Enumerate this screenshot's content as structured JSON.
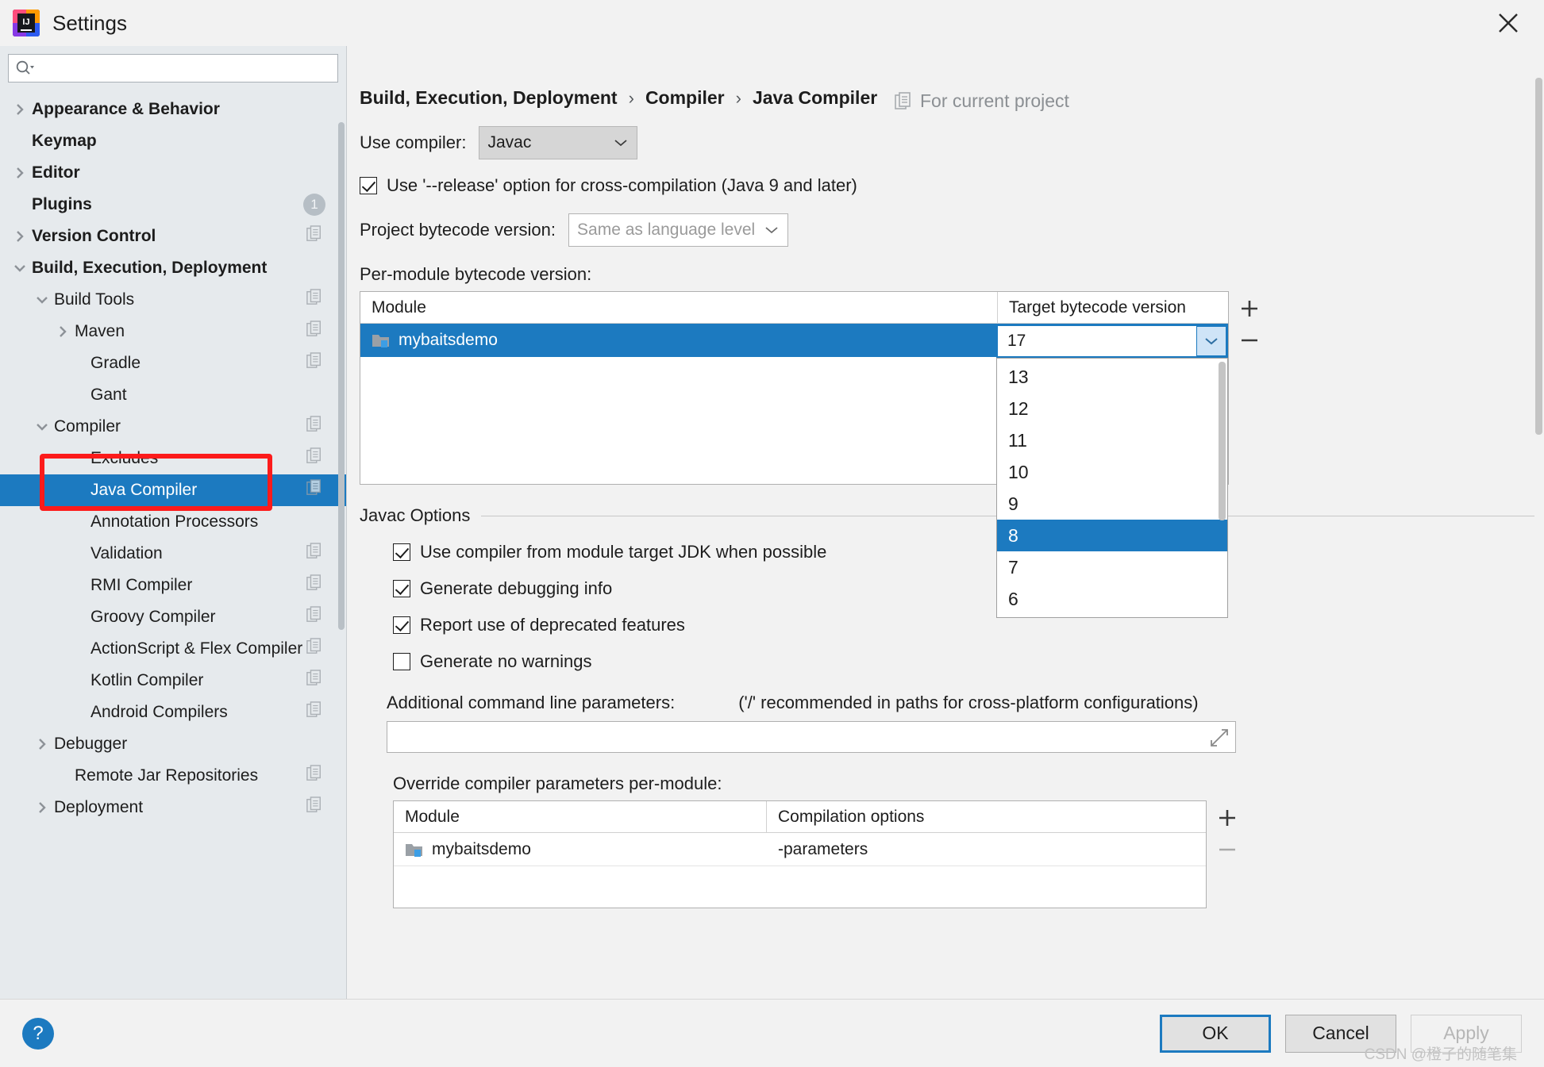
{
  "window": {
    "title": "Settings",
    "logo_text": "IJ",
    "close_icon": "close-icon"
  },
  "search": {
    "placeholder": "",
    "value": "",
    "icon": "search-icon"
  },
  "sidebar": {
    "items": [
      {
        "label": "Appearance & Behavior",
        "level": 0,
        "bold": true,
        "arrow": "right",
        "selected": false,
        "right_icon": false,
        "badge": ""
      },
      {
        "label": "Keymap",
        "level": 0,
        "bold": true,
        "arrow": "none",
        "selected": false,
        "right_icon": false,
        "badge": ""
      },
      {
        "label": "Editor",
        "level": 0,
        "bold": true,
        "arrow": "right",
        "selected": false,
        "right_icon": false,
        "badge": ""
      },
      {
        "label": "Plugins",
        "level": 0,
        "bold": true,
        "arrow": "none",
        "selected": false,
        "right_icon": false,
        "badge": "1"
      },
      {
        "label": "Version Control",
        "level": 0,
        "bold": true,
        "arrow": "right",
        "selected": false,
        "right_icon": true,
        "badge": ""
      },
      {
        "label": "Build, Execution, Deployment",
        "level": 0,
        "bold": true,
        "arrow": "down",
        "selected": false,
        "right_icon": false,
        "badge": ""
      },
      {
        "label": "Build Tools",
        "level": 1,
        "bold": false,
        "arrow": "down",
        "selected": false,
        "right_icon": true,
        "badge": ""
      },
      {
        "label": "Maven",
        "level": 2,
        "bold": false,
        "arrow": "right",
        "selected": false,
        "right_icon": true,
        "badge": ""
      },
      {
        "label": "Gradle",
        "level": 3,
        "bold": false,
        "arrow": "none",
        "selected": false,
        "right_icon": true,
        "badge": ""
      },
      {
        "label": "Gant",
        "level": 3,
        "bold": false,
        "arrow": "none",
        "selected": false,
        "right_icon": false,
        "badge": ""
      },
      {
        "label": "Compiler",
        "level": 1,
        "bold": false,
        "arrow": "down",
        "selected": false,
        "right_icon": true,
        "badge": ""
      },
      {
        "label": "Excludes",
        "level": 3,
        "bold": false,
        "arrow": "none",
        "selected": false,
        "right_icon": true,
        "badge": ""
      },
      {
        "label": "Java Compiler",
        "level": 3,
        "bold": false,
        "arrow": "none",
        "selected": true,
        "right_icon": true,
        "badge": ""
      },
      {
        "label": "Annotation Processors",
        "level": 3,
        "bold": false,
        "arrow": "none",
        "selected": false,
        "right_icon": false,
        "badge": ""
      },
      {
        "label": "Validation",
        "level": 3,
        "bold": false,
        "arrow": "none",
        "selected": false,
        "right_icon": true,
        "badge": ""
      },
      {
        "label": "RMI Compiler",
        "level": 3,
        "bold": false,
        "arrow": "none",
        "selected": false,
        "right_icon": true,
        "badge": ""
      },
      {
        "label": "Groovy Compiler",
        "level": 3,
        "bold": false,
        "arrow": "none",
        "selected": false,
        "right_icon": true,
        "badge": ""
      },
      {
        "label": "ActionScript & Flex Compiler",
        "level": 3,
        "bold": false,
        "arrow": "none",
        "selected": false,
        "right_icon": true,
        "badge": ""
      },
      {
        "label": "Kotlin Compiler",
        "level": 3,
        "bold": false,
        "arrow": "none",
        "selected": false,
        "right_icon": true,
        "badge": ""
      },
      {
        "label": "Android Compilers",
        "level": 3,
        "bold": false,
        "arrow": "none",
        "selected": false,
        "right_icon": true,
        "badge": ""
      },
      {
        "label": "Debugger",
        "level": 1,
        "bold": false,
        "arrow": "right",
        "selected": false,
        "right_icon": false,
        "badge": ""
      },
      {
        "label": "Remote Jar Repositories",
        "level": 2,
        "bold": false,
        "arrow": "none",
        "selected": false,
        "right_icon": true,
        "badge": ""
      },
      {
        "label": "Deployment",
        "level": 1,
        "bold": false,
        "arrow": "right",
        "selected": false,
        "right_icon": true,
        "badge": ""
      }
    ]
  },
  "header": {
    "breadcrumb": [
      "Build, Execution, Deployment",
      "Compiler",
      "Java Compiler"
    ],
    "separator": "›",
    "for_current_project": "For current project",
    "for_current_project_icon": "copy-icon"
  },
  "main": {
    "use_compiler_label": "Use compiler:",
    "use_compiler_value": "Javac",
    "release_option_label": "Use '--release' option for cross-compilation (Java 9 and later)",
    "release_option_checked": true,
    "project_bytecode_label": "Project bytecode version:",
    "project_bytecode_value": "Same as language level",
    "per_module_label": "Per-module bytecode version:",
    "module_table": {
      "columns": [
        "Module",
        "Target bytecode version"
      ],
      "rows": [
        {
          "module": "mybaitsdemo",
          "target": "17",
          "selected": true
        }
      ],
      "add_button": "+",
      "remove_button": "−"
    },
    "bytecode_dropdown": {
      "value": "17",
      "open": true,
      "options": [
        "13",
        "12",
        "11",
        "10",
        "9",
        "8",
        "7",
        "6"
      ],
      "highlighted": "8"
    },
    "javac_options": {
      "group_title": "Javac Options",
      "checkboxes": [
        {
          "label": "Use compiler from module target JDK when possible",
          "checked": true
        },
        {
          "label": "Generate debugging info",
          "checked": true
        },
        {
          "label": "Report use of deprecated features",
          "checked": true
        },
        {
          "label": "Generate no warnings",
          "checked": false
        }
      ],
      "additional_params_label": "Additional command line parameters:",
      "additional_params_hint": "('/' recommended in paths for cross-platform configurations)",
      "additional_params_value": "",
      "expand_icon": "expand-icon"
    },
    "override_section": {
      "label": "Override compiler parameters per-module:",
      "columns": [
        "Module",
        "Compilation options"
      ],
      "rows": [
        {
          "module": "mybaitsdemo",
          "options": "-parameters"
        }
      ],
      "add_button": "+",
      "remove_button": "−"
    }
  },
  "footer": {
    "help_label": "?",
    "ok_label": "OK",
    "cancel_label": "Cancel",
    "apply_label": "Apply",
    "apply_disabled": true,
    "watermark": "CSDN @橙子的随笔集"
  },
  "colors": {
    "accent": "#1c7ac0",
    "sidebar_bg": "#e6eaed",
    "panel_bg": "#f2f2f2",
    "annotation": "#fc1b1b"
  }
}
